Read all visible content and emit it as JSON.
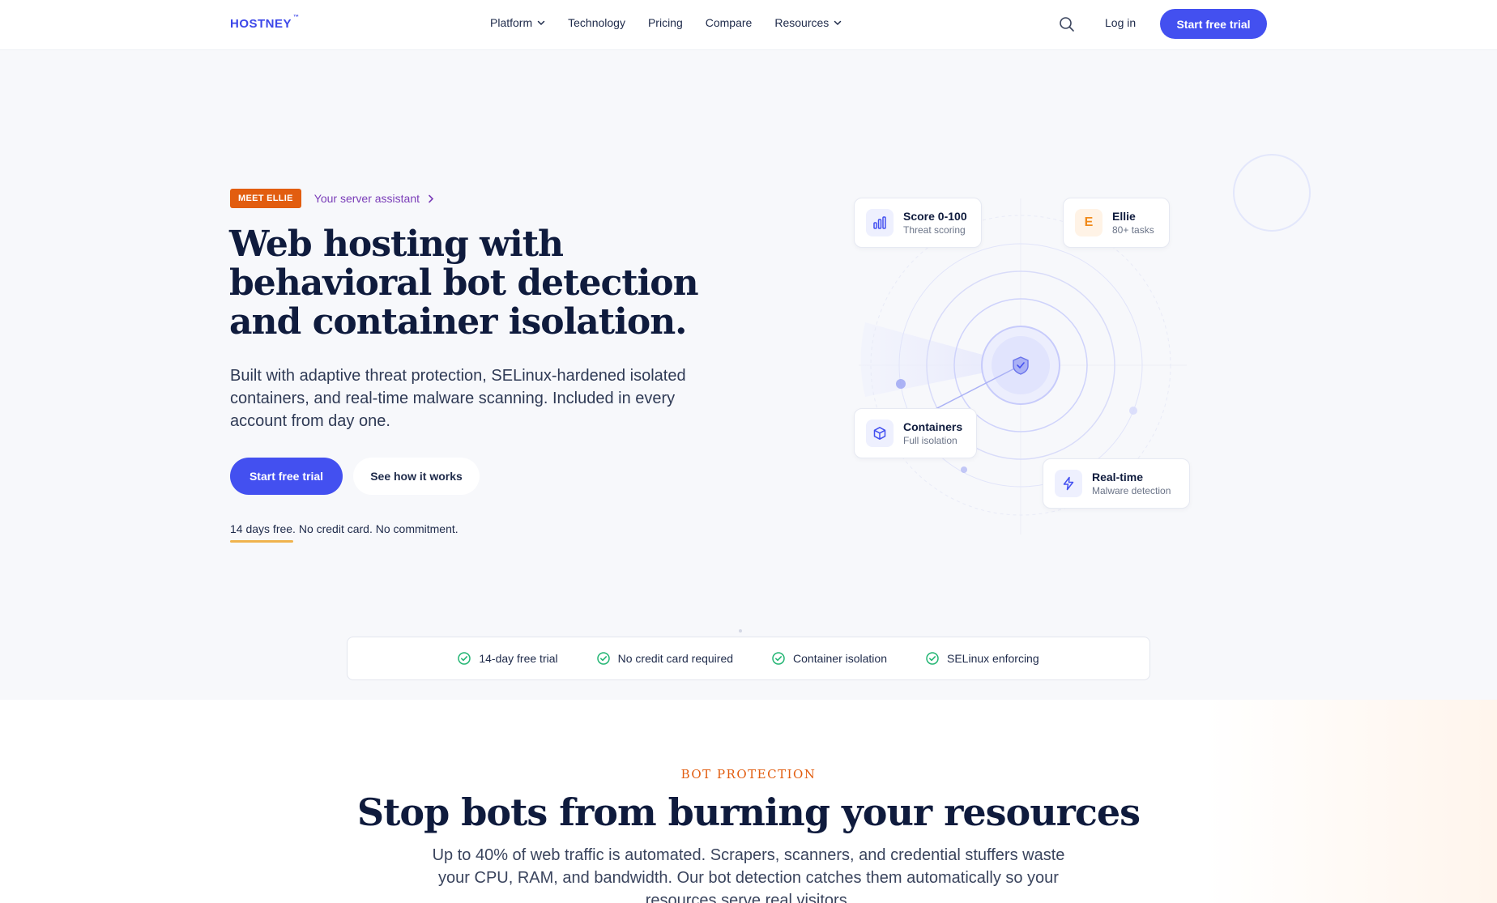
{
  "brand": {
    "name": "HOSTNEY",
    "tm": "™"
  },
  "nav": {
    "items": [
      {
        "label": "Platform",
        "has_dropdown": true
      },
      {
        "label": "Technology",
        "has_dropdown": false
      },
      {
        "label": "Pricing",
        "has_dropdown": false
      },
      {
        "label": "Compare",
        "has_dropdown": false
      },
      {
        "label": "Resources",
        "has_dropdown": true
      }
    ],
    "search_icon": "search-icon",
    "login": "Log in",
    "cta": "Start free trial"
  },
  "hero": {
    "badge": "MEET ELLIE",
    "assistant_link": "Your server assistant",
    "headline": "Web hosting with behavioral bot detection and container isolation.",
    "subtext": "Built with adaptive threat protection, SELinux-hardened isolated containers, and real-time malware scanning. Included in every account from day one.",
    "primary_cta": "Start free trial",
    "secondary_cta": "See how it works",
    "note": "14 days free. No credit card. No commitment."
  },
  "visual": {
    "cards": [
      {
        "title": "Score 0-100",
        "subtitle": "Threat scoring",
        "icon": "bar-chart-icon"
      },
      {
        "title": "Ellie",
        "subtitle": "80+ tasks",
        "icon": "ellie-letter-icon",
        "letter": "E"
      },
      {
        "title": "Containers",
        "subtitle": "Full isolation",
        "icon": "cube-icon"
      },
      {
        "title": "Real-time",
        "subtitle": "Malware detection",
        "icon": "bolt-icon"
      }
    ]
  },
  "trust_strip": [
    "14-day free trial",
    "No credit card required",
    "Container isolation",
    "SELinux enforcing"
  ],
  "section": {
    "eyebrow": "BOT PROTECTION",
    "title": "Stop bots from burning your resources",
    "subtext": "Up to 40% of web traffic is automated. Scrapers, scanners, and credential stuffers waste your CPU, RAM, and bandwidth. Our bot detection catches them automatically so your resources serve real visitors."
  },
  "colors": {
    "accent": "#4350f0",
    "brand_text": "#3c47e9",
    "badge_orange": "#e25d0f",
    "heading": "#0f1b3d",
    "check_green": "#22b573",
    "link_purple": "#7a3db8"
  }
}
